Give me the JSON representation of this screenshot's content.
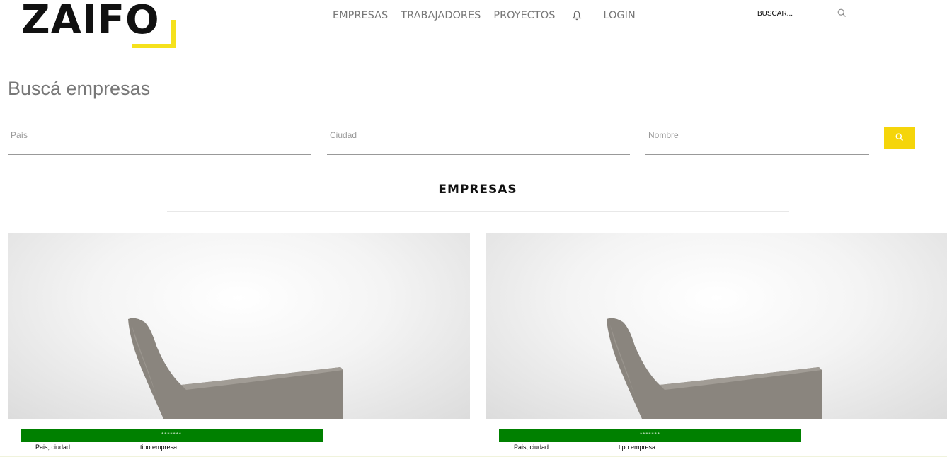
{
  "brand": {
    "name": "ZAIFO",
    "accent_color": "#f5e11c"
  },
  "nav": {
    "items": [
      {
        "label": "EMPRESAS"
      },
      {
        "label": "TRABAJADORES"
      },
      {
        "label": "PROYECTOS"
      },
      {
        "icon": "bell-icon"
      },
      {
        "label": "LOGIN"
      }
    ],
    "search_placeholder": "BUSCAR...",
    "search_icon": "search-icon"
  },
  "page": {
    "title": "Buscá empresas"
  },
  "filters": {
    "pais_placeholder": "País",
    "ciudad_placeholder": "Ciudad",
    "nombre_placeholder": "Nombre",
    "search_button_icon": "search-icon",
    "button_color": "#f5d50a"
  },
  "section": {
    "title": "EMPRESAS"
  },
  "cards": [
    {
      "name": "*******",
      "location": "Pais, ciudad",
      "type": "tipo empresa",
      "name_bar_color": "#008000"
    },
    {
      "name": "*******",
      "location": "Pais, ciudad",
      "type": "tipo empresa",
      "name_bar_color": "#008000"
    }
  ]
}
